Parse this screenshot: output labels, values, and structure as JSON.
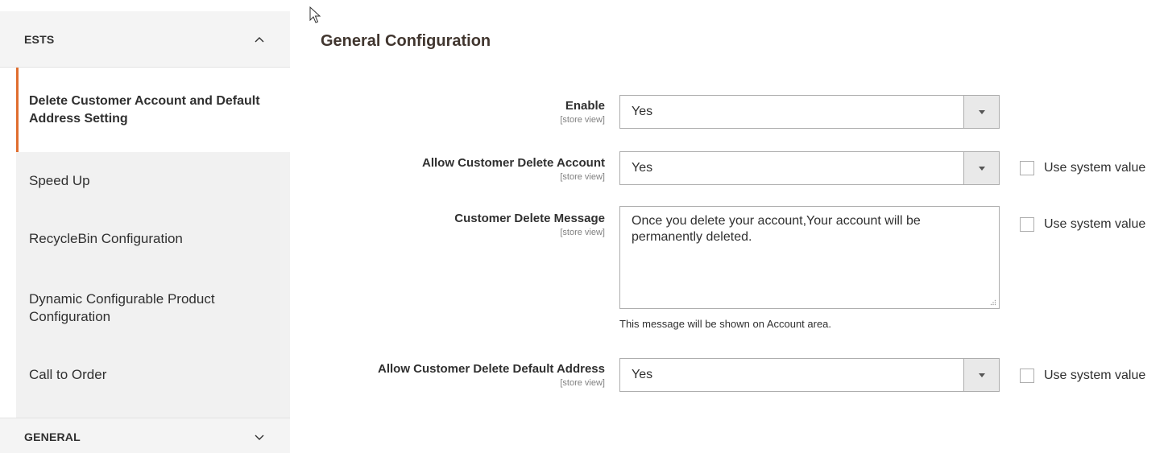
{
  "sidebar": {
    "sections": [
      {
        "title": "ESTS",
        "state": "expanded",
        "icon": "chevron-up-icon"
      },
      {
        "title": "GENERAL",
        "state": "collapsed",
        "icon": "chevron-down-icon"
      }
    ],
    "items": [
      {
        "label": "Delete Customer Account and Default Address Setting",
        "active": true
      },
      {
        "label": "Speed Up",
        "active": false
      },
      {
        "label": "RecycleBin Configuration",
        "active": false
      },
      {
        "label": "Dynamic Configurable Product Configuration",
        "active": false
      },
      {
        "label": "Call to Order",
        "active": false
      }
    ],
    "active_accent": "#e06e2f"
  },
  "main": {
    "title": "General Configuration",
    "fields": [
      {
        "label": "Enable",
        "scope": "[store view]",
        "value": "Yes"
      },
      {
        "label": "Allow Customer Delete Account",
        "scope": "[store view]",
        "value": "Yes",
        "use_system_value": "Use system value"
      },
      {
        "label": "Customer Delete Message",
        "scope": "[store view]",
        "value": "Once you delete your account,Your account will be permanently deleted.",
        "note": "This message will be shown on Account area.",
        "use_system_value": "Use system value"
      },
      {
        "label": "Allow Customer Delete Default Address",
        "scope": "[store view]",
        "value": "Yes",
        "use_system_value": "Use system value"
      }
    ]
  }
}
